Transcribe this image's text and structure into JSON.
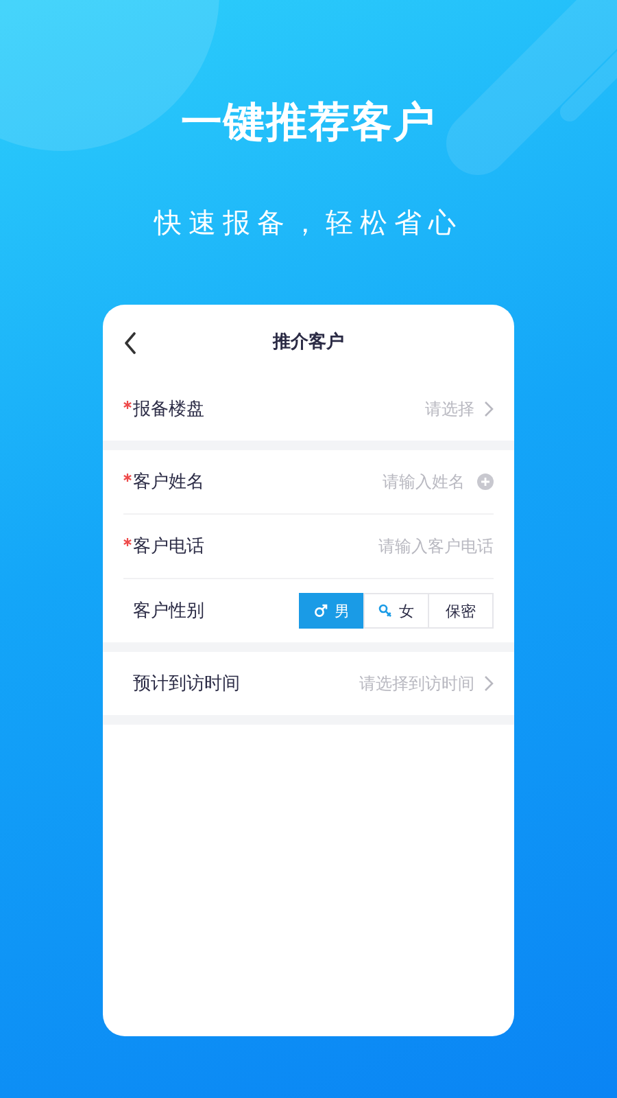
{
  "headline": "一键推荐客户",
  "subtitle": "快速报备，轻松省心",
  "screen": {
    "title": "推介客户",
    "sections": [
      {
        "rows": [
          {
            "kind": "select",
            "label": "报备楼盘",
            "required": true,
            "placeholder": "请选择"
          }
        ]
      },
      {
        "rows": [
          {
            "kind": "input-add",
            "label": "客户姓名",
            "required": true,
            "placeholder": "请输入姓名"
          },
          {
            "kind": "input",
            "label": "客户电话",
            "required": true,
            "placeholder": "请输入客户电话"
          },
          {
            "kind": "segmented",
            "label": "客户性别",
            "required": false,
            "options": [
              {
                "kind": "male",
                "label": "男",
                "selected": true
              },
              {
                "kind": "female",
                "label": "女",
                "selected": false
              },
              {
                "kind": "text",
                "label": "保密",
                "selected": false
              }
            ]
          }
        ]
      },
      {
        "rows": [
          {
            "kind": "select",
            "label": "预计到访时间",
            "required": false,
            "placeholder": "请选择到访时间"
          }
        ]
      }
    ]
  }
}
